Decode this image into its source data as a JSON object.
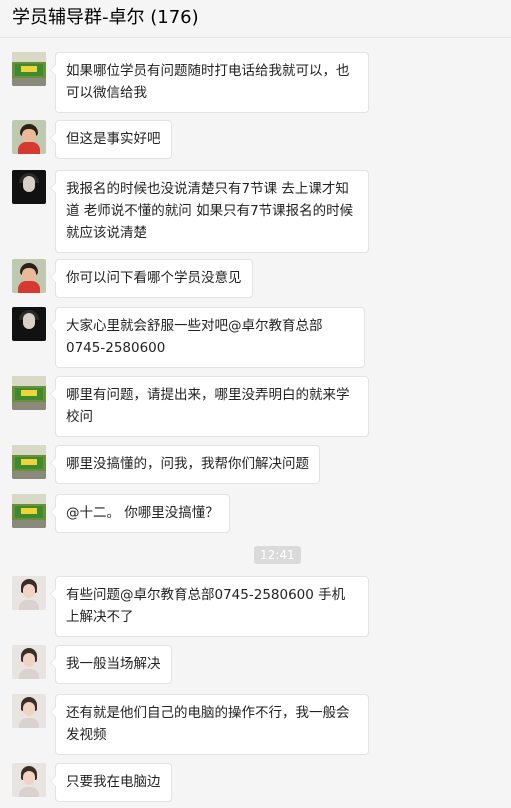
{
  "window": {
    "title": "学员辅导群-卓尔 (176)"
  },
  "time_separator": "12:41",
  "messages": [
    {
      "avatar": "office-photo-avatar",
      "text": "如果哪位学员有问题随时打电话给我就可以，也可以微信给我"
    },
    {
      "avatar": "boy-photo-avatar",
      "text": "但这是事实好吧"
    },
    {
      "avatar": "dark-portrait-avatar",
      "text": "我报名的时候也没说清楚只有7节课 去上课才知道 老师说不懂的就问 如果只有7节课报名的时候就应该说清楚"
    },
    {
      "avatar": "boy-photo-avatar",
      "text": "你可以问下看哪个学员没意见"
    },
    {
      "avatar": "dark-portrait-avatar",
      "text": "大家心里就会舒服一些对吧@卓尔教育总部0745-2580600"
    },
    {
      "avatar": "office-photo-avatar",
      "text": "哪里有问题，请提出来，哪里没弄明白的就来学校问"
    },
    {
      "avatar": "office-photo-avatar",
      "text": "哪里没搞懂的，问我，我帮你们解决问题"
    },
    {
      "avatar": "office-photo-avatar",
      "text": "@十二。 你哪里没搞懂？"
    },
    {
      "avatar": "woman-photo-avatar",
      "text": "有些问题@卓尔教育总部0745-2580600 手机上解决不了"
    },
    {
      "avatar": "woman-photo-avatar",
      "text": "我一般当场解决"
    },
    {
      "avatar": "woman-photo-avatar",
      "text": "还有就是他们自己的电脑的操作不行，我一般会发视频"
    },
    {
      "avatar": "woman-photo-avatar",
      "text": "只要我在电脑边"
    }
  ]
}
